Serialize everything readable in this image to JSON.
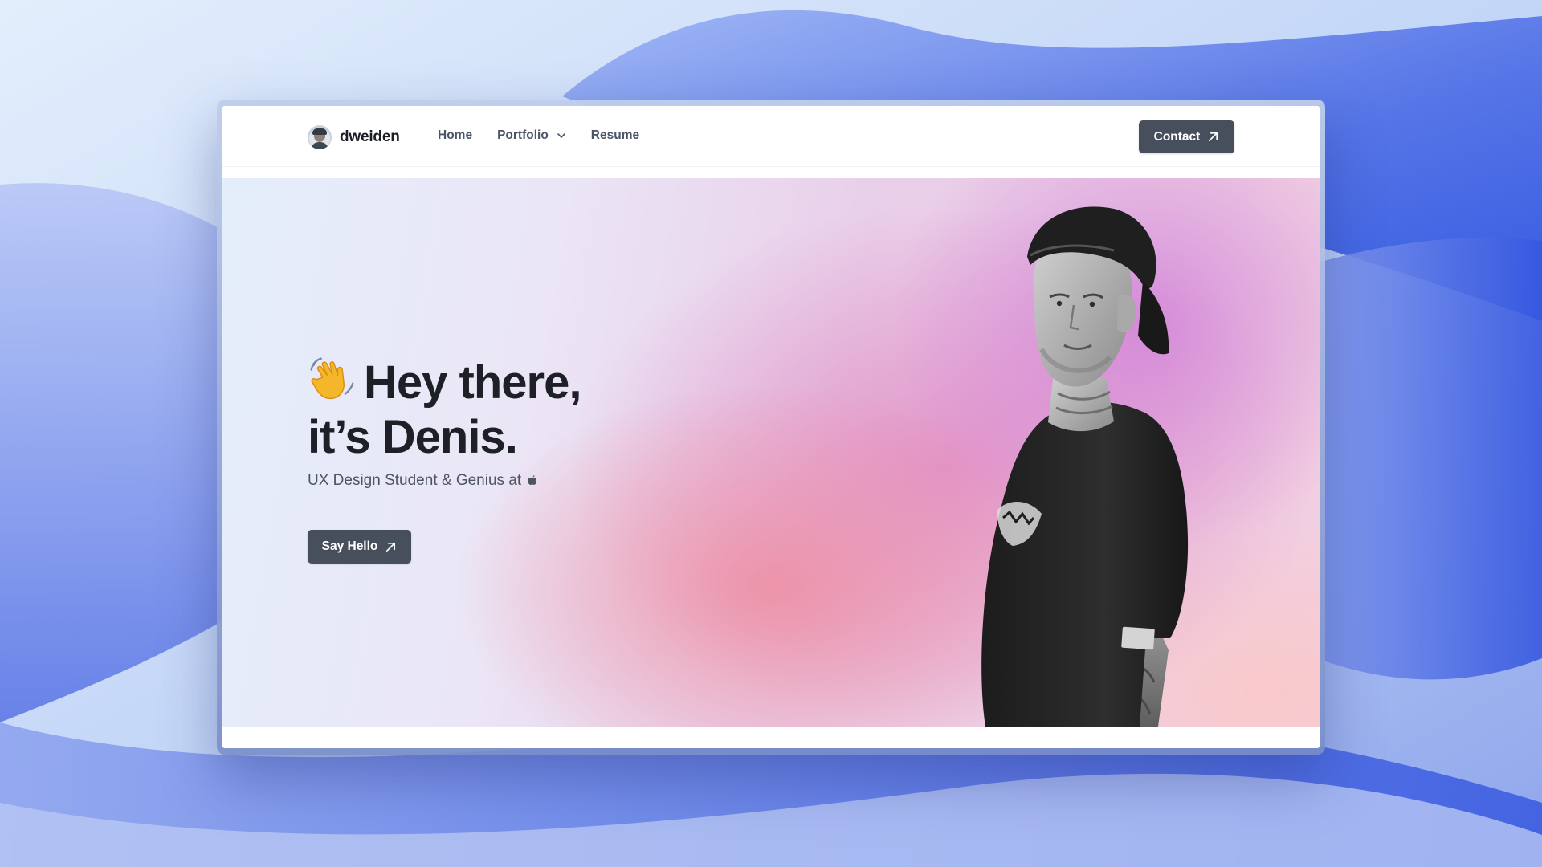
{
  "nav": {
    "brand": "dweiden",
    "links": [
      "Home",
      "Portfolio",
      "Resume"
    ],
    "contact_label": "Contact"
  },
  "hero": {
    "title_line1": "Hey there,",
    "title_line2": "it’s Denis.",
    "subtitle": "UX Design Student & Genius at",
    "cta_label": "Say Hello"
  },
  "icons": {
    "brand": "avatar",
    "dropdown": "chevron-down-icon",
    "external": "arrow-up-right-icon",
    "wave": "waving-hand-icon",
    "company": "apple-logo-icon"
  },
  "colors": {
    "button_bg": "#474f5c",
    "text_dark": "#1d2027",
    "nav_text": "#4a5568"
  }
}
